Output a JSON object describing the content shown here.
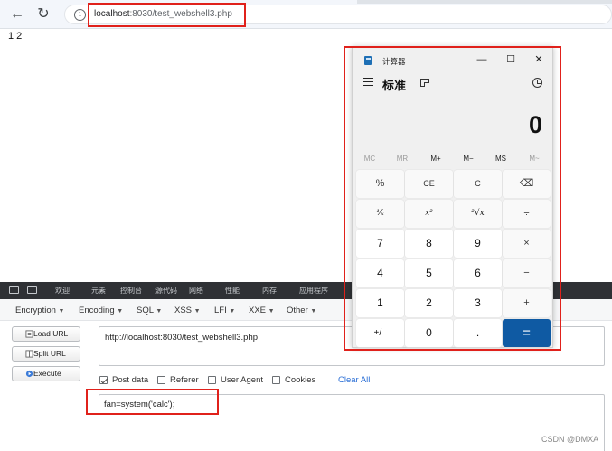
{
  "browser": {
    "url_host": "localhost",
    "url_path": ":8030/test_webshell3.php",
    "info_symbol": "i",
    "back_symbol": "←",
    "reload_symbol": "↻"
  },
  "page": {
    "output": "1 2"
  },
  "devtools": {
    "tabs": [
      "欢迎",
      "元素",
      "控制台",
      "源代码",
      "网络",
      "性能",
      "内存",
      "应用程序"
    ]
  },
  "hackbar": {
    "menu": [
      {
        "label": "Encryption"
      },
      {
        "label": "Encoding"
      },
      {
        "label": "SQL"
      },
      {
        "label": "XSS"
      },
      {
        "label": "LFI"
      },
      {
        "label": "XXE"
      },
      {
        "label": "Other"
      }
    ],
    "caret": "▼",
    "buttons": {
      "load_url": "Load URL",
      "split_url": "Split URL",
      "execute": "Execute"
    },
    "url_value": "http://localhost:8030/test_webshell3.php",
    "options": {
      "post_data": "Post data",
      "referer": "Referer",
      "user_agent": "User Agent",
      "cookies": "Cookies",
      "clear_all": "Clear All"
    },
    "post_value": "fan=system('calc');"
  },
  "calculator": {
    "title": "计算器",
    "mode": "标准",
    "display": "0",
    "window_controls": {
      "minimize": "—",
      "maximize": "☐",
      "close": "✕"
    },
    "memory": [
      "MC",
      "MR",
      "M+",
      "M−",
      "MS",
      "M~"
    ],
    "keys": [
      [
        "%",
        "CE",
        "C",
        "⌫"
      ],
      [
        "¹⁄ₓ",
        "x²",
        "²√x",
        "÷"
      ],
      [
        "7",
        "8",
        "9",
        "×"
      ],
      [
        "4",
        "5",
        "6",
        "−"
      ],
      [
        "1",
        "2",
        "3",
        "+"
      ],
      [
        "+/₋",
        "0",
        ".",
        "="
      ]
    ]
  },
  "watermark": "CSDN @DMXA",
  "colors": {
    "highlight": "#e0211b",
    "equals_key": "#0f5aa3",
    "link": "#2b6fd6"
  }
}
